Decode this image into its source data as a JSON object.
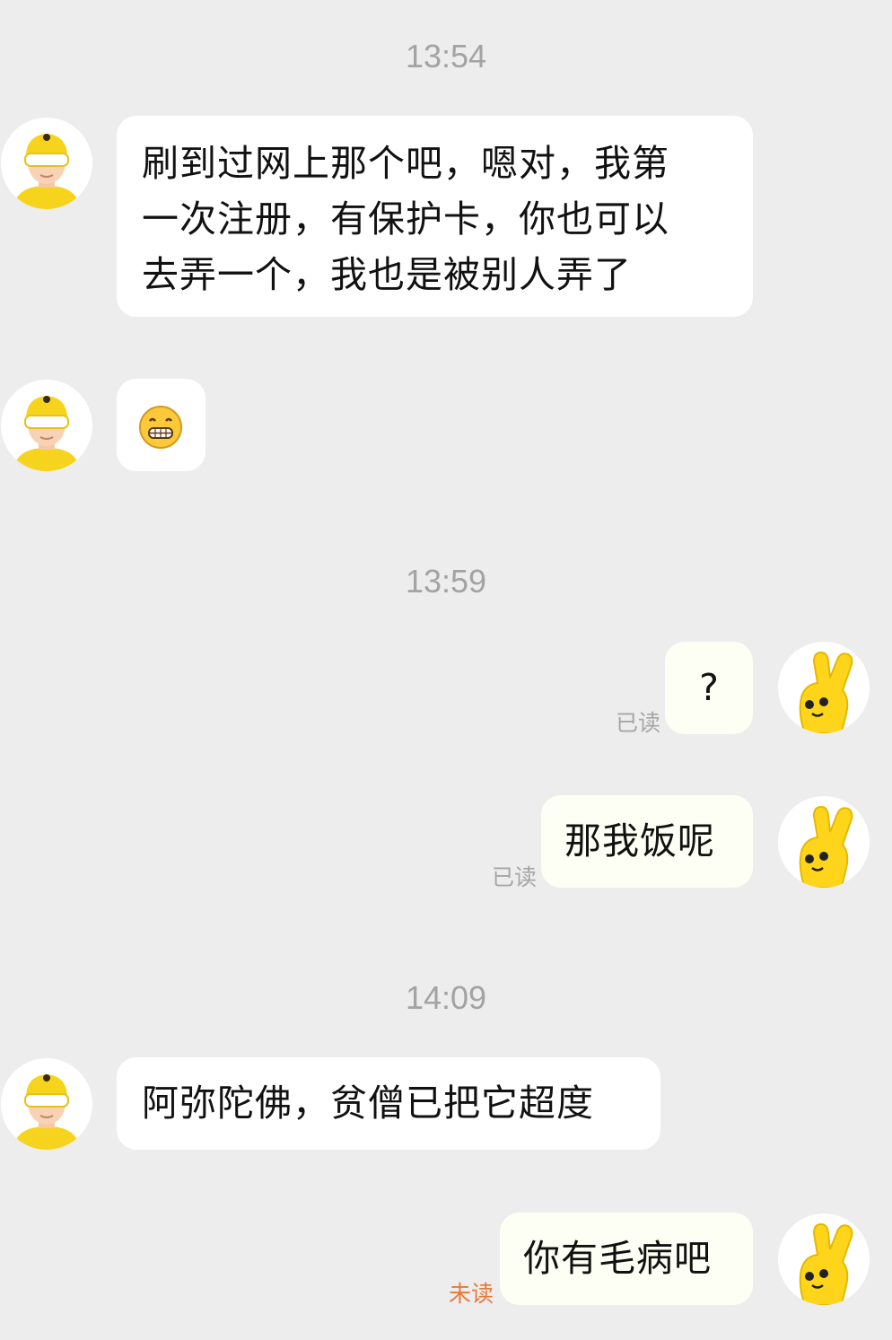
{
  "timestamps": [
    "13:54",
    "13:59",
    "14:09"
  ],
  "messages": [
    {
      "from": "other",
      "lines": [
        "刷到过网上那个吧，嗯对，我第",
        "一次注册，有保护卡，你也可以",
        "去弄一个，我也是被别人弄了"
      ]
    },
    {
      "from": "other",
      "emoji": "grin-emoji"
    },
    {
      "from": "me",
      "text": "?",
      "status": "已读"
    },
    {
      "from": "me",
      "text": "那我饭呢",
      "status": "已读"
    },
    {
      "from": "other",
      "text": "阿弥陀佛，贫僧已把它超度"
    },
    {
      "from": "me",
      "text": "你有毛病吧",
      "status": "未读"
    }
  ],
  "avatars": {
    "other": "yellow-helmet-person-icon",
    "me": "yellow-victory-hand-icon"
  },
  "colors": {
    "background": "#ededed",
    "bubble": "#ffffff",
    "read_status": "#a6a6a6",
    "unread_status": "#e8783a"
  }
}
